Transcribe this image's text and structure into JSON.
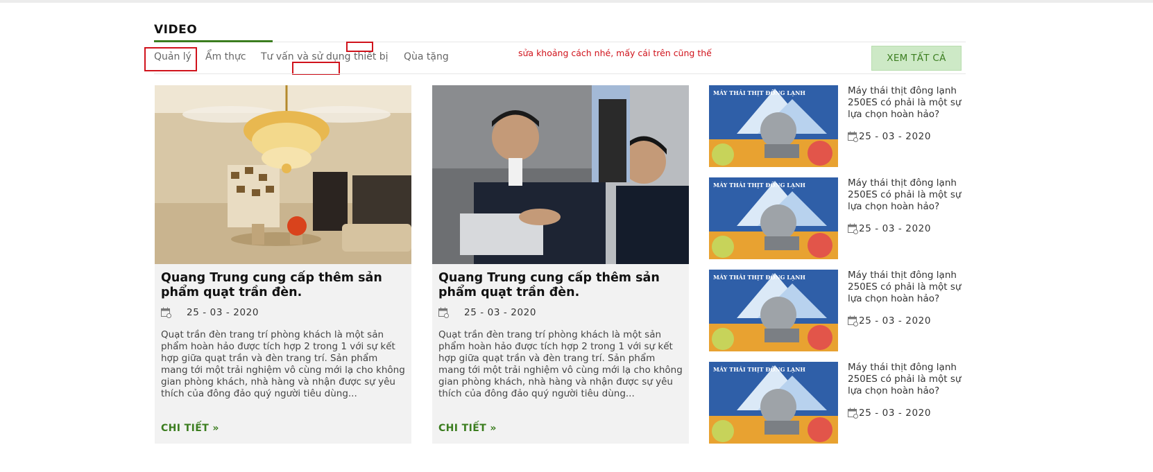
{
  "section": {
    "title": "VIDEO",
    "view_all_label": "XEM TẤT CẢ"
  },
  "tabs": [
    {
      "label": "Quản lý"
    },
    {
      "label": "Ẩm thực"
    },
    {
      "label": "Tư vấn và sử dụng thiết bị"
    },
    {
      "label": "Qùa tặng"
    }
  ],
  "annotation": {
    "note": "sửa khoảng cách nhé, mấy cái trên cũng thế",
    "color": "#d0121b"
  },
  "featured": [
    {
      "title": "Quang Trung cung cấp thêm sản phẩm quạt trần đèn.",
      "date": "25 - 03 - 2020",
      "excerpt": "Quạt trần đèn trang trí phòng khách là một sản phẩm hoàn hảo được tích hợp 2 trong 1 với sự kết hợp giữa quạt trần và đèn trang trí. Sản phẩm mang tới một trải nghiệm vô cùng mới lạ cho không gian phòng khách, nhà hàng và nhận được sự yêu thích của đông đảo quý người tiêu dùng...",
      "more_label": "CHI TIẾT »",
      "image": "chandelier-fan-living-room"
    },
    {
      "title": "Quang Trung cung cấp thêm sản phẩm quạt trần đèn.",
      "date": "25 - 03 - 2020",
      "excerpt": "Quạt trần đèn trang trí phòng khách là một sản phẩm hoàn hảo được tích hợp 2 trong 1 với sự kết hợp giữa quạt trần và đèn trang trí. Sản phẩm mang tới một trải nghiệm vô cùng mới lạ cho không gian phòng khách, nhà hàng và nhận được sự yêu thích của đông đảo quý người tiêu dùng...",
      "more_label": "CHI TIẾT »",
      "image": "business-meeting"
    }
  ],
  "sidebar": [
    {
      "title": "Máy thái thịt đông lạnh 250ES có phải là một sự lựa chọn hoàn hảo?",
      "date": "25 - 03 - 2020",
      "image_caption": "MÁY THÁI THỊT ĐÔNG LẠNH"
    },
    {
      "title": "Máy thái thịt đông lạnh 250ES có phải là một sự lựa chọn hoàn hảo?",
      "date": "25 - 03 - 2020",
      "image_caption": "MÁY THÁI THỊT ĐÔNG LẠNH"
    },
    {
      "title": "Máy thái thịt đông lạnh 250ES có phải là một sự lựa chọn hoàn hảo?",
      "date": "25 - 03 - 2020",
      "image_caption": "MÁY THÁI THỊT ĐÔNG LẠNH"
    },
    {
      "title": "Máy thái thịt đông lạnh 250ES có phải là một sự lựa chọn hoàn hảo?",
      "date": "25 - 03 - 2020",
      "image_caption": "MÁY THÁI THỊT ĐÔNG LẠNH"
    }
  ],
  "icons": {
    "calendar": "calendar-icon"
  },
  "colors": {
    "accent_green": "#3b7d1f",
    "view_all_bg": "#cde9c6",
    "card_bg": "#f2f2f2"
  }
}
